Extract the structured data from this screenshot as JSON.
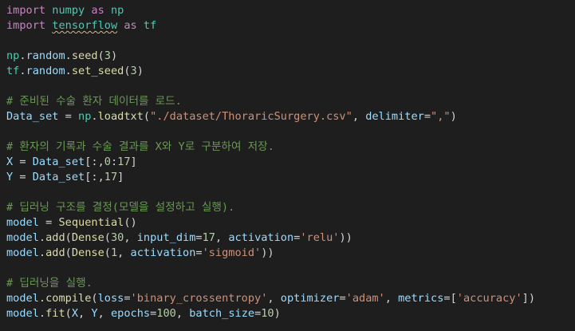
{
  "editor": {
    "lines": [
      [
        {
          "t": "import",
          "c": "kw"
        },
        {
          "t": " "
        },
        {
          "t": "numpy",
          "c": "mod"
        },
        {
          "t": " "
        },
        {
          "t": "as",
          "c": "kw"
        },
        {
          "t": " "
        },
        {
          "t": "np",
          "c": "mod"
        }
      ],
      [
        {
          "t": "import",
          "c": "kw"
        },
        {
          "t": " "
        },
        {
          "t": "tensorflow",
          "c": "mod",
          "u": true
        },
        {
          "t": " "
        },
        {
          "t": "as",
          "c": "kw"
        },
        {
          "t": " "
        },
        {
          "t": "tf",
          "c": "mod"
        }
      ],
      [],
      [
        {
          "t": "np",
          "c": "mod"
        },
        {
          "t": "."
        },
        {
          "t": "random",
          "c": "var"
        },
        {
          "t": "."
        },
        {
          "t": "seed",
          "c": "fn"
        },
        {
          "t": "("
        },
        {
          "t": "3",
          "c": "num"
        },
        {
          "t": ")"
        }
      ],
      [
        {
          "t": "tf",
          "c": "mod"
        },
        {
          "t": "."
        },
        {
          "t": "random",
          "c": "var"
        },
        {
          "t": "."
        },
        {
          "t": "set_seed",
          "c": "fn"
        },
        {
          "t": "("
        },
        {
          "t": "3",
          "c": "num"
        },
        {
          "t": ")"
        }
      ],
      [],
      [
        {
          "t": "# 준비된 수술 환자 데이터를 로드.",
          "c": "com"
        }
      ],
      [
        {
          "t": "Data_set",
          "c": "var"
        },
        {
          "t": " = "
        },
        {
          "t": "np",
          "c": "mod"
        },
        {
          "t": "."
        },
        {
          "t": "loadtxt",
          "c": "fn"
        },
        {
          "t": "("
        },
        {
          "t": "\"./dataset/ThoraricSurgery.csv\"",
          "c": "str"
        },
        {
          "t": ", "
        },
        {
          "t": "delimiter",
          "c": "var"
        },
        {
          "t": "="
        },
        {
          "t": "\",\"",
          "c": "str"
        },
        {
          "t": ")"
        }
      ],
      [],
      [
        {
          "t": "# 환자의 기록과 수술 결과를 X와 Y로 구분하여 저장.",
          "c": "com"
        }
      ],
      [
        {
          "t": "X",
          "c": "var"
        },
        {
          "t": " = "
        },
        {
          "t": "Data_set",
          "c": "var"
        },
        {
          "t": "[:,"
        },
        {
          "t": "0",
          "c": "num"
        },
        {
          "t": ":"
        },
        {
          "t": "17",
          "c": "num"
        },
        {
          "t": "]"
        }
      ],
      [
        {
          "t": "Y",
          "c": "var"
        },
        {
          "t": " = "
        },
        {
          "t": "Data_set",
          "c": "var"
        },
        {
          "t": "[:,"
        },
        {
          "t": "17",
          "c": "num"
        },
        {
          "t": "]"
        }
      ],
      [],
      [
        {
          "t": "# 딥러닝 구조를 결정(모델을 설정하고 실행).",
          "c": "com"
        }
      ],
      [
        {
          "t": "model",
          "c": "var"
        },
        {
          "t": " = "
        },
        {
          "t": "Sequential",
          "c": "fn"
        },
        {
          "t": "()"
        }
      ],
      [
        {
          "t": "model",
          "c": "var"
        },
        {
          "t": "."
        },
        {
          "t": "add",
          "c": "fn"
        },
        {
          "t": "("
        },
        {
          "t": "Dense",
          "c": "fn"
        },
        {
          "t": "("
        },
        {
          "t": "30",
          "c": "num"
        },
        {
          "t": ", "
        },
        {
          "t": "input_dim",
          "c": "var"
        },
        {
          "t": "="
        },
        {
          "t": "17",
          "c": "num"
        },
        {
          "t": ", "
        },
        {
          "t": "activation",
          "c": "var"
        },
        {
          "t": "="
        },
        {
          "t": "'relu'",
          "c": "str"
        },
        {
          "t": "))"
        }
      ],
      [
        {
          "t": "model",
          "c": "var"
        },
        {
          "t": "."
        },
        {
          "t": "add",
          "c": "fn"
        },
        {
          "t": "("
        },
        {
          "t": "Dense",
          "c": "fn"
        },
        {
          "t": "("
        },
        {
          "t": "1",
          "c": "num"
        },
        {
          "t": ", "
        },
        {
          "t": "activation",
          "c": "var"
        },
        {
          "t": "="
        },
        {
          "t": "'sigmoid'",
          "c": "str"
        },
        {
          "t": "))"
        }
      ],
      [],
      [
        {
          "t": "# 딥러닝을 실행.",
          "c": "com"
        }
      ],
      [
        {
          "t": "model",
          "c": "var"
        },
        {
          "t": "."
        },
        {
          "t": "compile",
          "c": "fn"
        },
        {
          "t": "("
        },
        {
          "t": "loss",
          "c": "var"
        },
        {
          "t": "="
        },
        {
          "t": "'binary_crossentropy'",
          "c": "str"
        },
        {
          "t": ", "
        },
        {
          "t": "optimizer",
          "c": "var"
        },
        {
          "t": "="
        },
        {
          "t": "'adam'",
          "c": "str"
        },
        {
          "t": ", "
        },
        {
          "t": "metrics",
          "c": "var"
        },
        {
          "t": "=["
        },
        {
          "t": "'accuracy'",
          "c": "str"
        },
        {
          "t": "])"
        }
      ],
      [
        {
          "t": "model",
          "c": "var"
        },
        {
          "t": "."
        },
        {
          "t": "fit",
          "c": "fn"
        },
        {
          "t": "("
        },
        {
          "t": "X",
          "c": "var"
        },
        {
          "t": ", "
        },
        {
          "t": "Y",
          "c": "var"
        },
        {
          "t": ", "
        },
        {
          "t": "epochs",
          "c": "var"
        },
        {
          "t": "="
        },
        {
          "t": "100",
          "c": "num"
        },
        {
          "t": ", "
        },
        {
          "t": "batch_size",
          "c": "var"
        },
        {
          "t": "="
        },
        {
          "t": "10",
          "c": "num"
        },
        {
          "t": ")"
        }
      ]
    ]
  }
}
